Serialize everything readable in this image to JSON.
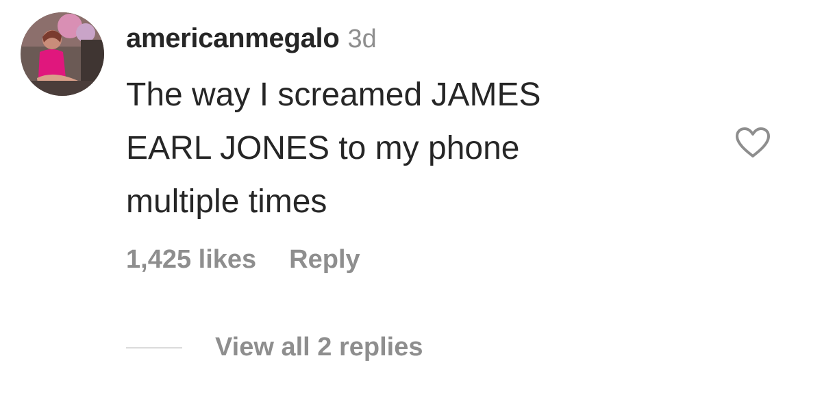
{
  "comment": {
    "username": "americanmegalo",
    "timestamp": "3d",
    "text_lines": [
      "The way I screamed JAMES",
      "EARL JONES to my phone",
      "multiple times"
    ],
    "likes": "1,425 likes",
    "reply_label": "Reply",
    "view_replies_label": "View all 2 replies"
  },
  "icons": {
    "like": "heart-outline-icon"
  },
  "colors": {
    "primary_text": "#262626",
    "secondary_text": "#8e8e8e",
    "divider": "#dbdbdb"
  }
}
